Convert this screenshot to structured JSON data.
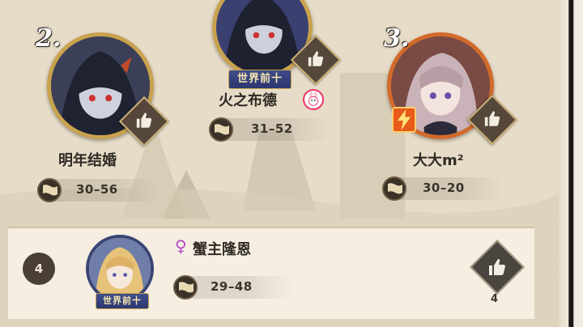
{
  "colors": {
    "gold_frame": "#c9a24e",
    "orange_frame": "#d26a2a",
    "badge_blue": "#2c3770",
    "text_dark": "#2f2a24",
    "female_pink": "#b24ac4"
  },
  "players": [
    {
      "rank": "2.",
      "name": "明年结婚",
      "score": "30–56"
    },
    {
      "rank": "",
      "name": "火之布德",
      "score": "31–52",
      "title_badge": "世界前十"
    },
    {
      "rank": "3.",
      "name": "大大m²",
      "score": "30–20"
    }
  ],
  "fourth": {
    "rank": "4",
    "gender_icon": "♀",
    "name": "蟹主隆恩",
    "score": "29–48",
    "title_badge": "世界前十",
    "like_count": "4"
  },
  "icons": {
    "like": "thumbs-up-icon",
    "flag": "flag-icon",
    "rabbit": "rabbit-badge-icon",
    "flash": "lightning-icon"
  }
}
